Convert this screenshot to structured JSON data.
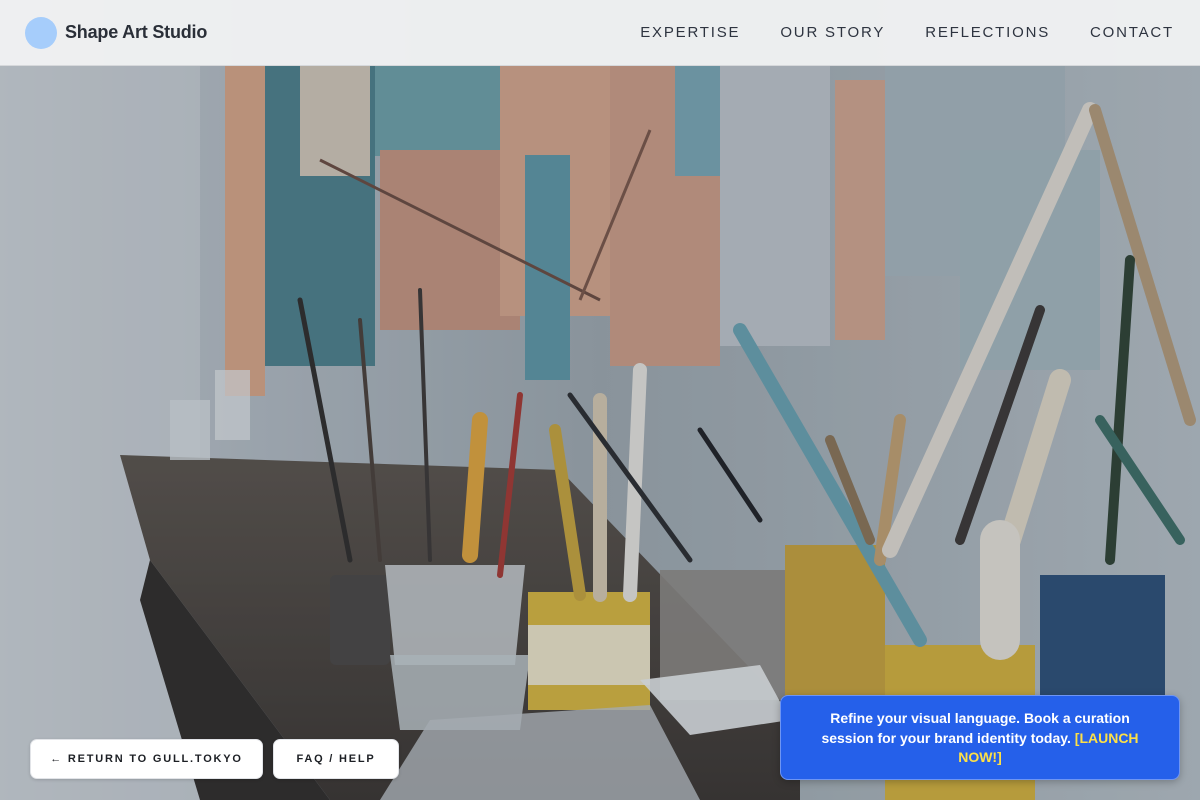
{
  "brand": {
    "name": "Shape Art Studio",
    "logo_color": "#a6cdfb"
  },
  "nav": {
    "items": [
      {
        "label": "EXPERTISE"
      },
      {
        "label": "OUR STORY"
      },
      {
        "label": "REFLECTIONS"
      },
      {
        "label": "CONTACT"
      }
    ]
  },
  "hero": {
    "image_icon": "art-studio-brushes-image"
  },
  "footer": {
    "return_label": "← RETURN TO GULL.TOKYO",
    "faq_label": "FAQ / HELP"
  },
  "promo": {
    "text": "Refine your visual language. Book a curation session for your brand identity today.",
    "cta": "[LAUNCH NOW!]",
    "background": "#2560ea",
    "cta_color": "#fde047"
  }
}
